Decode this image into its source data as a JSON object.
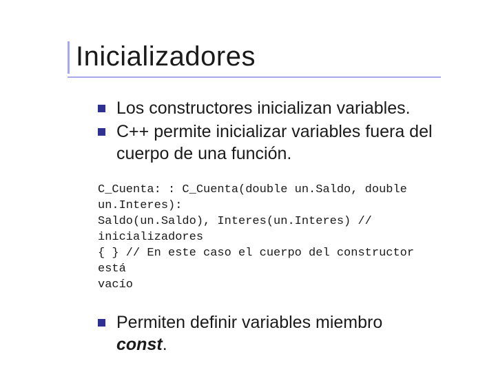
{
  "title": "Inicializadores",
  "bullets_a": [
    "Los constructores inicializan variables.",
    "C++ permite inicializar variables fuera del cuerpo de una función."
  ],
  "code": {
    "l1": "C_Cuenta: : C_Cuenta(double un.Saldo, double un.Interes):",
    "l2": "Saldo(un.Saldo), Interes(un.Interes) // inicializadores",
    "l3": "{ } // En este caso el cuerpo del constructor está",
    "l4": "vacío"
  },
  "bullets_b": {
    "text": "Permiten definir variables miembro ",
    "kw": "const",
    "tail": "."
  }
}
